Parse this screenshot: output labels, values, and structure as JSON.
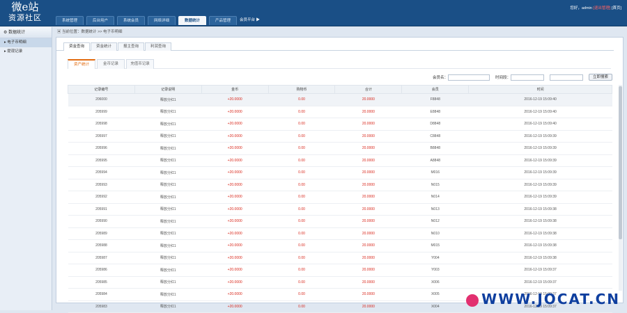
{
  "brand": {
    "line1": "微e站",
    "line2": "资源社区"
  },
  "nav": {
    "tabs": [
      "系统管理",
      "后台用户",
      "系统会员",
      "网络详细",
      "数据统计",
      "产品管理"
    ],
    "active": 4,
    "more": "会员平台 ▶"
  },
  "user": {
    "greeting": "您好，admin",
    "logout": "[退出管理]",
    "home": "[首页]"
  },
  "sidebar": {
    "head": "数据统计",
    "items": [
      "电子币明细",
      "提现记录"
    ]
  },
  "breadcrumb": "当前位置：数据统计 >> 电子币明细",
  "tabs1": [
    "资金查询",
    "资金统计",
    "报主查询",
    "利润查询"
  ],
  "tabs2": [
    "资产统计",
    "金币记录",
    "充值币记录"
  ],
  "filters": {
    "member_label": "会员名：",
    "time_label": "时间段：",
    "search": "立即搜索"
  },
  "columns": [
    "记录编号",
    "记录说明",
    "金币",
    "购物币",
    "合计",
    "会员",
    "时间"
  ],
  "rows": [
    [
      "206000",
      "释放分红1",
      "+20.0000",
      "0.00",
      "20.0000",
      "F8848",
      "2016-12-19 15:09:40"
    ],
    [
      "205999",
      "释放分红1",
      "+20.0000",
      "0.00",
      "20.0000",
      "E8848",
      "2016-12-19 15:09:40"
    ],
    [
      "205998",
      "释放分红1",
      "+20.0000",
      "0.00",
      "20.0000",
      "D8848",
      "2016-12-19 15:09:40"
    ],
    [
      "205997",
      "释放分红1",
      "+20.0000",
      "0.00",
      "20.0000",
      "C8848",
      "2016-12-19 15:09:39"
    ],
    [
      "205996",
      "释放分红1",
      "+20.0000",
      "0.00",
      "20.0000",
      "B8848",
      "2016-12-19 15:09:39"
    ],
    [
      "205995",
      "释放分红1",
      "+20.0000",
      "0.00",
      "20.0000",
      "A8848",
      "2016-12-19 15:09:39"
    ],
    [
      "205994",
      "释放分红1",
      "+20.0000",
      "0.00",
      "20.0000",
      "M016",
      "2016-12-19 15:09:39"
    ],
    [
      "205993",
      "释放分红1",
      "+20.0000",
      "0.00",
      "20.0000",
      "N015",
      "2016-12-19 15:09:39"
    ],
    [
      "205992",
      "释放分红1",
      "+20.0000",
      "0.00",
      "20.0000",
      "N014",
      "2016-12-19 15:09:39"
    ],
    [
      "205991",
      "释放分红1",
      "+20.0000",
      "0.00",
      "20.0000",
      "N013",
      "2016-12-19 15:09:38"
    ],
    [
      "205990",
      "释放分红1",
      "+20.0000",
      "0.00",
      "20.0000",
      "N012",
      "2016-12-19 15:09:38"
    ],
    [
      "205989",
      "释放分红1",
      "+20.0000",
      "0.00",
      "20.0000",
      "N010",
      "2016-12-19 15:09:38"
    ],
    [
      "205988",
      "释放分红1",
      "+20.0000",
      "0.00",
      "20.0000",
      "M015",
      "2016-12-19 15:09:38"
    ],
    [
      "205987",
      "释放分红1",
      "+20.0000",
      "0.00",
      "20.0000",
      "Y004",
      "2016-12-19 15:09:38"
    ],
    [
      "205986",
      "释放分红1",
      "+20.0000",
      "0.00",
      "20.0000",
      "Y003",
      "2016-12-19 15:09:37"
    ],
    [
      "205985",
      "释放分红1",
      "+20.0000",
      "0.00",
      "20.0000",
      "X006",
      "2016-12-19 15:09:37"
    ],
    [
      "205984",
      "释放分红1",
      "+20.0000",
      "0.00",
      "20.0000",
      "X005",
      "2016-12-19 15:09:37"
    ],
    [
      "205983",
      "释放分红1",
      "+20.0000",
      "0.00",
      "20.0000",
      "X004",
      "2016-12-19 15:09:37"
    ]
  ],
  "watermark": "WWW.JOCAT.CN"
}
